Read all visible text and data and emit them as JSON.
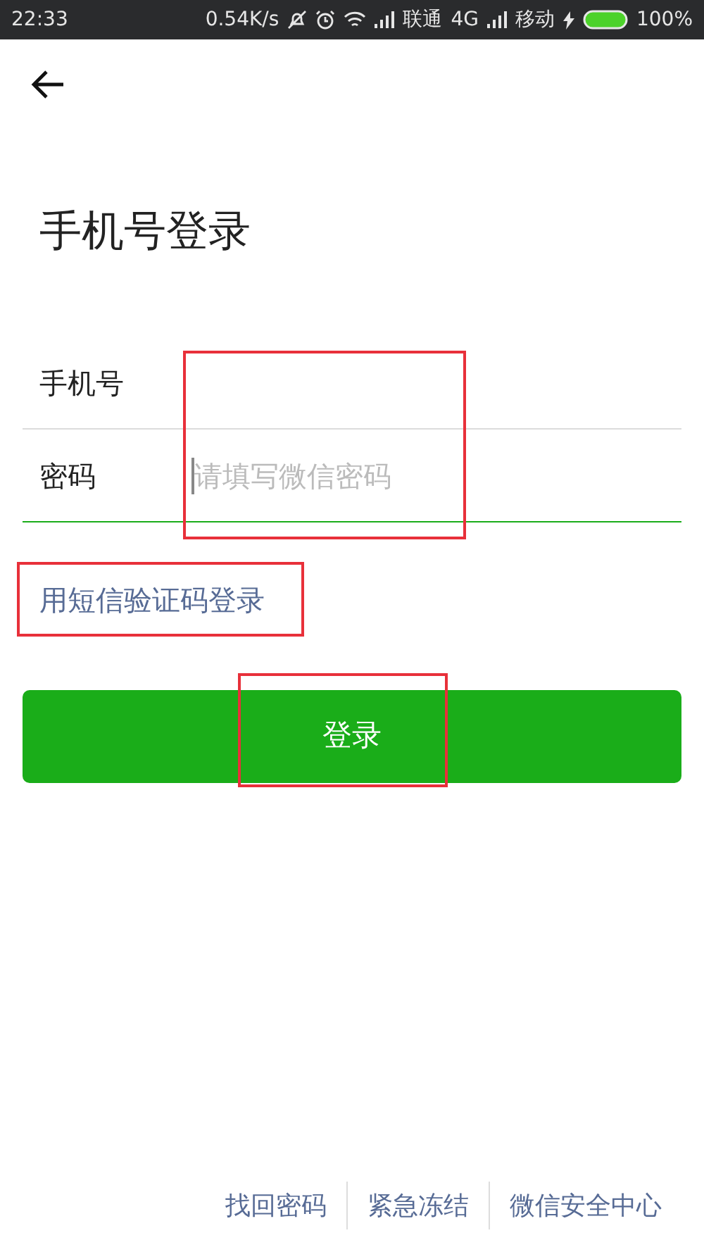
{
  "status_bar": {
    "time": "22:33",
    "speed": "0.54K/s",
    "carrier_1": "联通",
    "network_1": "4G",
    "carrier_2": "移动",
    "battery": "100%"
  },
  "title": "手机号登录",
  "fields": {
    "highlighted": true,
    "items": [
      {
        "label": "手机号",
        "focused": false
      },
      {
        "label": "密码",
        "placeholder": "请填写微信密码",
        "focused": true
      }
    ]
  },
  "sms_login": {
    "label": "用短信验证码登录",
    "highlighted": true
  },
  "login_button": {
    "label": "登录",
    "highlighted": true
  },
  "footer_links": [
    "找回密码",
    "紧急冻结",
    "微信安全中心"
  ]
}
